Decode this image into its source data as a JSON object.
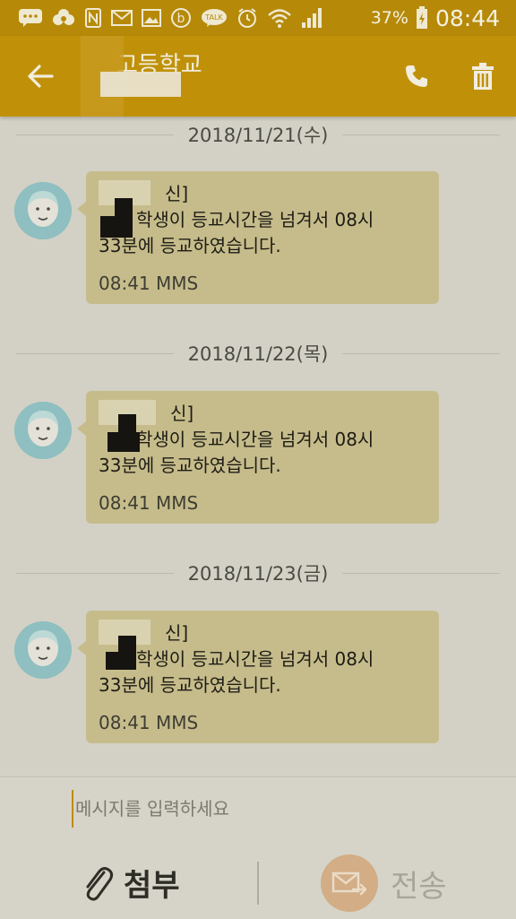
{
  "status_bar": {
    "icons": [
      "sms-icon",
      "flower-icon",
      "nfc-icon",
      "mail-icon",
      "gallery-icon",
      "b-app-icon",
      "kakaotalk-icon",
      "alarm-icon",
      "wifi-icon",
      "signal-icon"
    ],
    "kakao_label": "TALK",
    "battery": "37%",
    "time": "08:44"
  },
  "header": {
    "title": "고등학교"
  },
  "composer": {
    "placeholder": "메시지를 입력하세요",
    "attach_label": "첨부",
    "send_label": "전송"
  },
  "conversation": [
    {
      "date": "2018/11/21(수)",
      "sender": "신]",
      "line1": "학생이 등교시간을 넘겨서 08시",
      "line2": "33분에 등교하였습니다.",
      "meta": "08:41 MMS"
    },
    {
      "date": "2018/11/22(목)",
      "sender": "신]",
      "line1": "학생이 등교시간을 넘겨서 08시",
      "line2": "33분에 등교하였습니다.",
      "meta": "08:41 MMS"
    },
    {
      "date": "2018/11/23(금)",
      "sender": "신]",
      "line1": "학생이 등교시간을 넘겨서 08시",
      "line2": "33분에 등교하였습니다.",
      "meta": "08:41 MMS"
    }
  ],
  "colors": {
    "status_bar": "#b68a08",
    "app_bar": "#c09108",
    "background": "#d3d1c5",
    "bubble": "#c6bc8b",
    "send_circle": "#d2ad85"
  }
}
